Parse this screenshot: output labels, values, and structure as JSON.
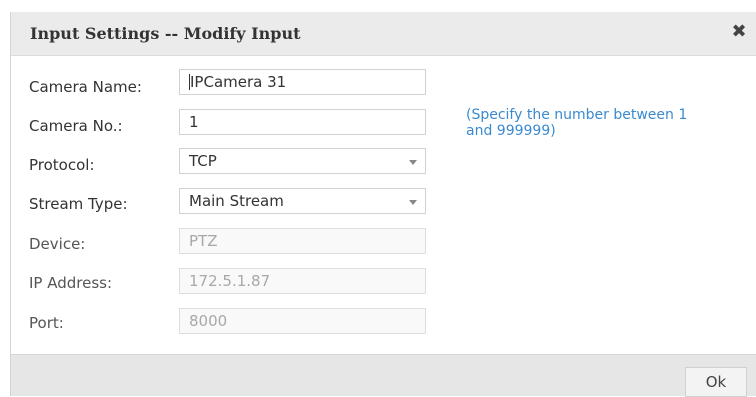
{
  "dialog": {
    "title": "Input Settings -- Modify Input",
    "close_icon": "close-icon",
    "close_glyph": "✖"
  },
  "form": {
    "fields": [
      {
        "label": "Camera Name:",
        "value": "IPCamera 31",
        "kind": "text",
        "enabled": true,
        "has_cursor": true
      },
      {
        "label": "Camera No.:",
        "value": "1",
        "kind": "text",
        "enabled": true
      },
      {
        "label": "Protocol:",
        "value": "TCP",
        "kind": "select",
        "enabled": true
      },
      {
        "label": "Stream Type:",
        "value": "Main Stream",
        "kind": "select",
        "enabled": true
      },
      {
        "label": "Device:",
        "value": "PTZ",
        "kind": "text",
        "enabled": false
      },
      {
        "label": "IP Address:",
        "value": "172.5.1.87",
        "kind": "text",
        "enabled": false
      },
      {
        "label": "Port:",
        "value": "8000",
        "kind": "text",
        "enabled": false
      }
    ],
    "hint": "(Specify the number between 1 and 999999)"
  },
  "footer": {
    "ok_label": "Ok"
  },
  "colors": {
    "hint": "#3a8ad0",
    "titlebar": "#ebebeb",
    "footer": "#e6e6e6"
  }
}
